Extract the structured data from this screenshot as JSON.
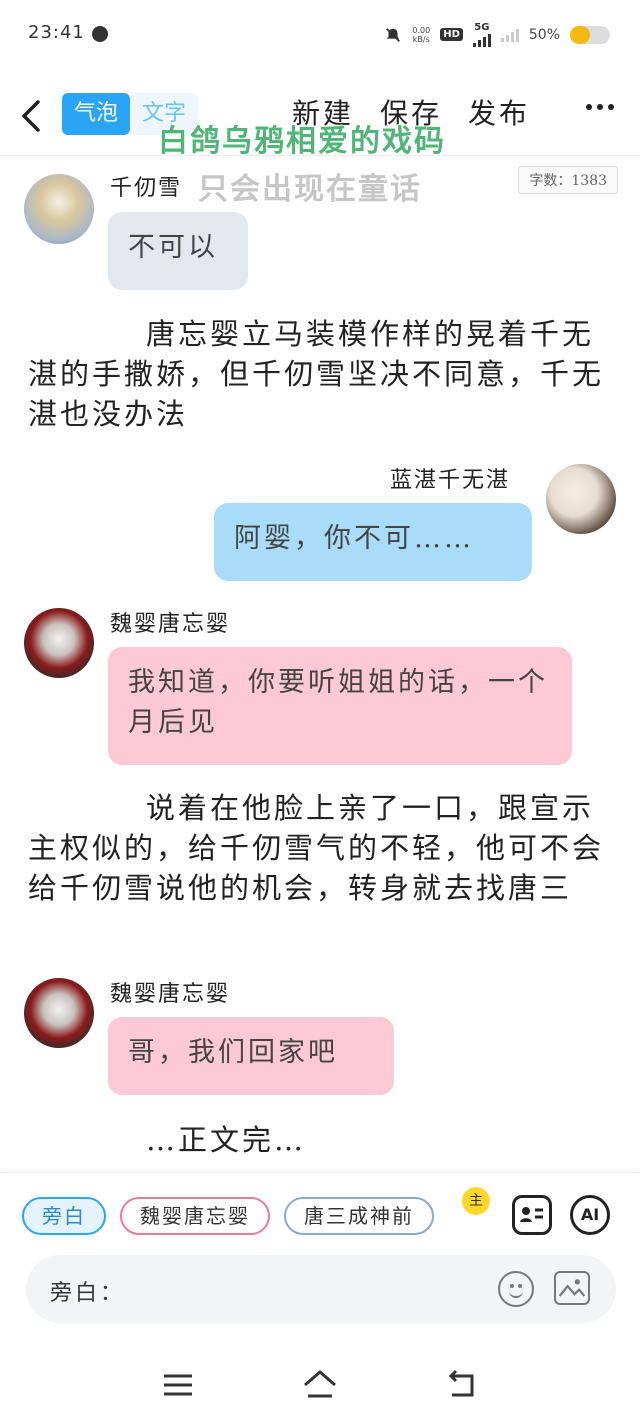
{
  "status": {
    "time": "23:41",
    "speed_top": "0.00",
    "speed_bottom": "kB/s",
    "hd": "HD",
    "network": "5G",
    "battery": "50%",
    "battery_level": 0.5
  },
  "toolbar": {
    "tabs": [
      "气泡",
      "文字"
    ],
    "active_tab": "气泡",
    "actions": [
      "新建",
      "保存",
      "发布"
    ]
  },
  "watermarks": [
    "白鸽乌鸦相爱的戏码",
    "只会出现在童话"
  ],
  "word_count": "字数：1383",
  "chat": [
    {
      "type": "message",
      "speaker": "千仞雪",
      "text": "不可以"
    },
    {
      "type": "narration",
      "text": "唐忘婴立马装模作样的晃着千无湛的手撒娇，但千仞雪坚决不同意，千无湛也没办法"
    },
    {
      "type": "message",
      "speaker": "蓝湛千无湛",
      "text": "阿婴，你不可……"
    },
    {
      "type": "message",
      "speaker": "魏婴唐忘婴",
      "text": "我知道，你要听姐姐的话，一个月后见"
    },
    {
      "type": "narration",
      "text": "说着在他脸上亲了一口，跟宣示主权似的，给千仞雪气的不轻，他可不会给千仞雪说他的机会，转身就去找唐三"
    },
    {
      "type": "message",
      "speaker": "魏婴唐忘婴",
      "text": "哥，我们回家吧"
    },
    {
      "type": "narration",
      "text": "…正文完…"
    }
  ],
  "characters": [
    "旁白",
    "魏婴唐忘婴",
    "唐三成神前"
  ],
  "more_badge": "主",
  "ai_label": "AI",
  "input": {
    "label": "旁白："
  },
  "colors": {
    "accent": "#2aa4f4",
    "bubble_grey": "#e3e8ef",
    "bubble_blue": "#a9dcf8",
    "bubble_pink": "#fdc9d6"
  }
}
